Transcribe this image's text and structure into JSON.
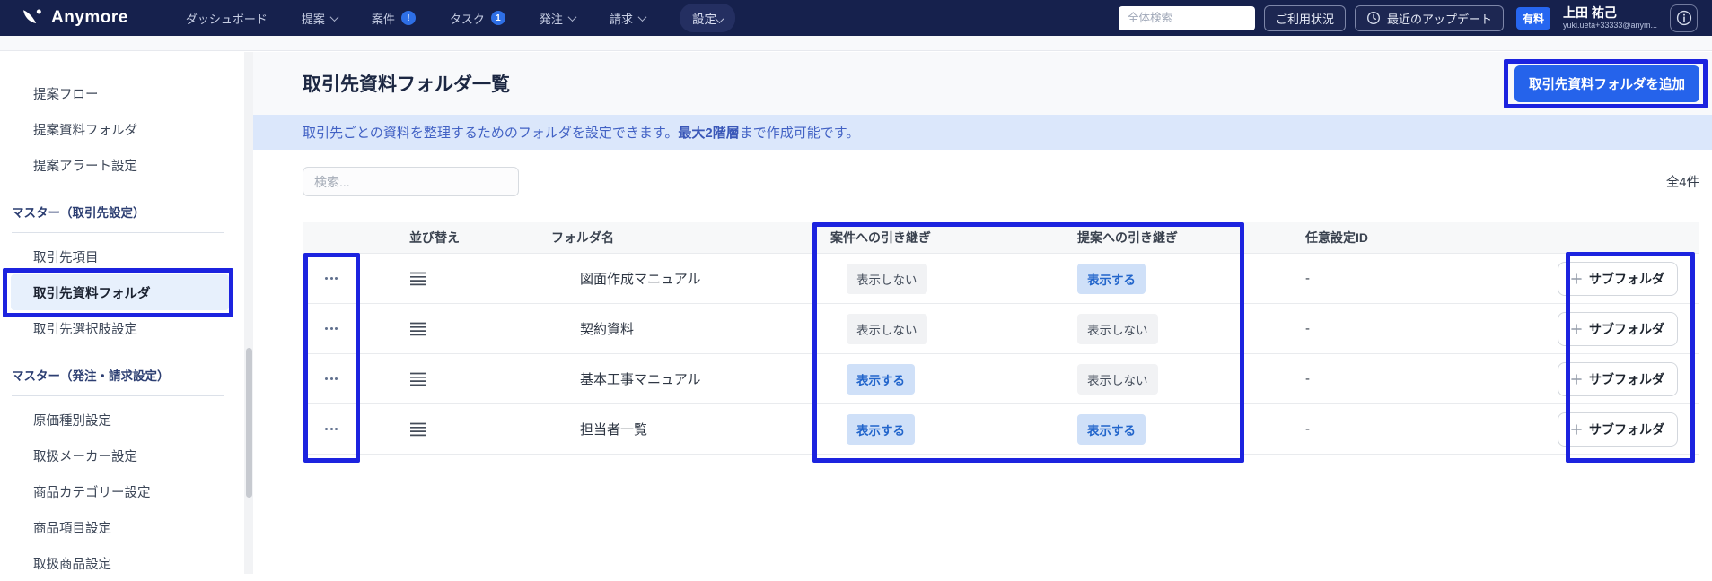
{
  "nav": {
    "brand": "Anymore",
    "dashboard": "ダッシュボード",
    "proposal": "提案",
    "cases": "案件",
    "cases_badge": "!",
    "tasks": "タスク",
    "tasks_badge": "1",
    "orders": "発注",
    "billing": "請求",
    "settings": "設定",
    "search_placeholder": "全体検索",
    "usage_button": "ご利用状況",
    "updates_button": "最近のアップデート",
    "plan_badge": "有料",
    "user_name": "上田 祐己",
    "user_email": "yuki.ueta+33333@anym..."
  },
  "sidebar": {
    "items": [
      {
        "label": "提案フロー"
      },
      {
        "label": "提案資料フォルダ"
      },
      {
        "label": "提案アラート設定"
      }
    ],
    "heading1": "マスター（取引先設定）",
    "group1": [
      {
        "label": "取引先項目"
      },
      {
        "label": "取引先資料フォルダ",
        "selected": true
      },
      {
        "label": "取引先選択肢設定"
      }
    ],
    "heading2": "マスター（発注・請求設定）",
    "group2": [
      {
        "label": "原価種別設定"
      },
      {
        "label": "取扱メーカー設定"
      },
      {
        "label": "商品カテゴリー設定"
      },
      {
        "label": "商品項目設定"
      },
      {
        "label": "取扱商品設定"
      }
    ]
  },
  "main": {
    "title": "取引先資料フォルダ一覧",
    "add_button": "取引先資料フォルダを追加",
    "banner": {
      "text_before": "取引先ごとの資料を整理するためのフォルダを設定できます。",
      "text_bold": "最大2階層",
      "text_after": "まで作成可能です。"
    },
    "search_placeholder": "検索...",
    "total_count": "全4件",
    "table": {
      "headers": {
        "sort": "並び替え",
        "folder": "フォルダ名",
        "case_handover": "案件への引き継ぎ",
        "proposal_handover": "提案への引き継ぎ",
        "custom_id": "任意設定ID"
      },
      "rows": [
        {
          "folder": "図面作成マニュアル",
          "case": {
            "label": "表示しない",
            "state": "hide"
          },
          "proposal": {
            "label": "表示する",
            "state": "show"
          },
          "custom_id": "-",
          "subfolder": "サブフォルダ"
        },
        {
          "folder": "契約資料",
          "case": {
            "label": "表示しない",
            "state": "hide"
          },
          "proposal": {
            "label": "表示しない",
            "state": "hide"
          },
          "custom_id": "-",
          "subfolder": "サブフォルダ"
        },
        {
          "folder": "基本工事マニュアル",
          "case": {
            "label": "表示する",
            "state": "show"
          },
          "proposal": {
            "label": "表示しない",
            "state": "hide"
          },
          "custom_id": "-",
          "subfolder": "サブフォルダ"
        },
        {
          "folder": "担当者一覧",
          "case": {
            "label": "表示する",
            "state": "show"
          },
          "proposal": {
            "label": "表示する",
            "state": "show"
          },
          "custom_id": "-",
          "subfolder": "サブフォルダ"
        }
      ]
    }
  },
  "colors": {
    "nav_bg": "#16214d",
    "accent": "#2563eb",
    "annotation": "#1c23df",
    "banner_bg": "#dbe7fb",
    "badge_on_bg": "#cfe0f8",
    "badge_on_text": "#2265cb"
  }
}
